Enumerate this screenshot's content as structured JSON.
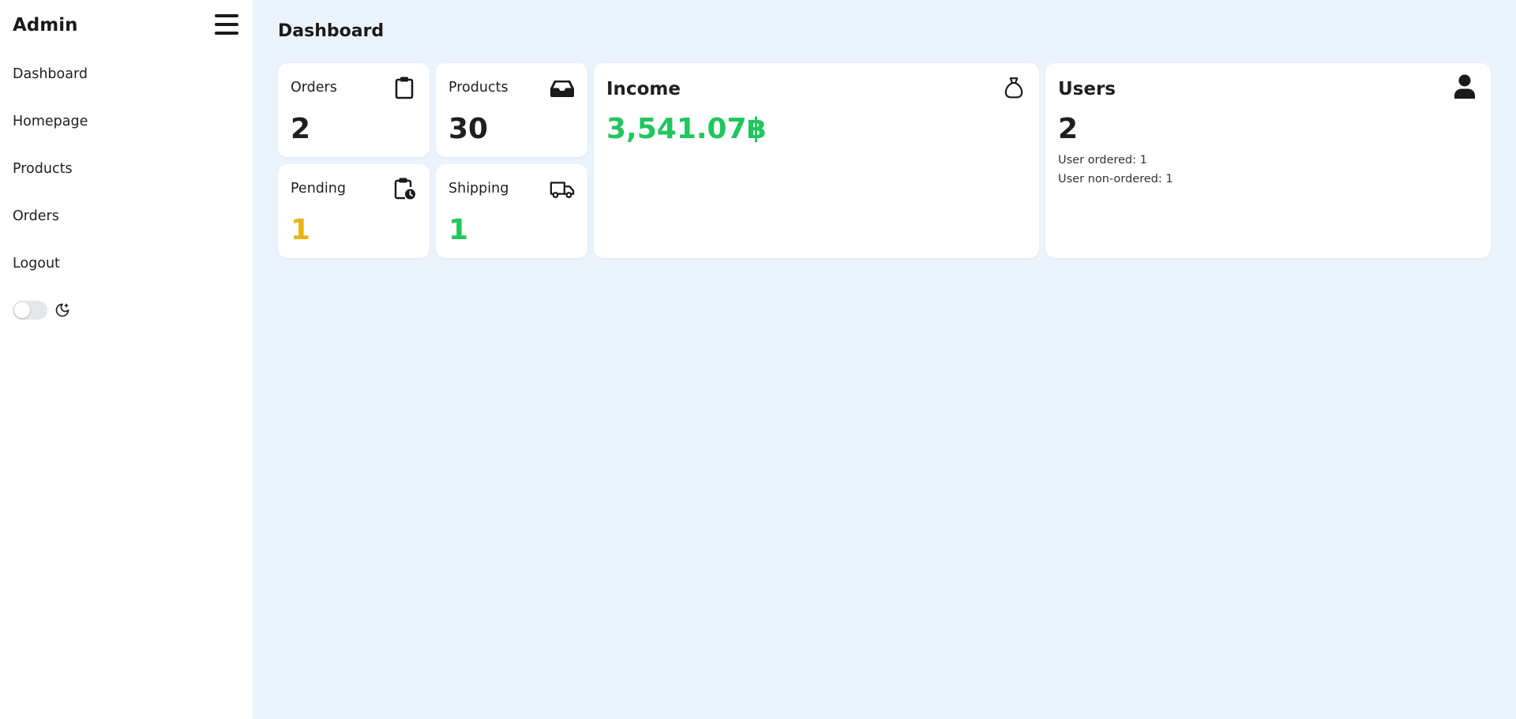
{
  "app": {
    "brand": "Admin"
  },
  "nav": {
    "items": [
      "Dashboard",
      "Homepage",
      "Products",
      "Orders",
      "Logout"
    ]
  },
  "theme": {
    "icon": "moon-stars-icon",
    "dark_mode": false
  },
  "page": {
    "title": "Dashboard"
  },
  "cards": {
    "orders": {
      "label": "Orders",
      "value": "2",
      "icon": "clipboard-icon"
    },
    "products": {
      "label": "Products",
      "value": "30",
      "icon": "inbox-tray-icon"
    },
    "pending": {
      "label": "Pending",
      "value": "1",
      "icon": "clipboard-clock-icon",
      "color": "#eab308"
    },
    "shipping": {
      "label": "Shipping",
      "value": "1",
      "icon": "truck-icon",
      "color": "#22c55e"
    },
    "income": {
      "label": "Income",
      "value": "3,541.07฿",
      "icon": "money-bag-icon",
      "color": "#22c55e"
    },
    "users": {
      "label": "Users",
      "value": "2",
      "icon": "user-icon",
      "ordered": "User ordered: 1",
      "non_ordered": "User non-ordered: 1"
    }
  }
}
